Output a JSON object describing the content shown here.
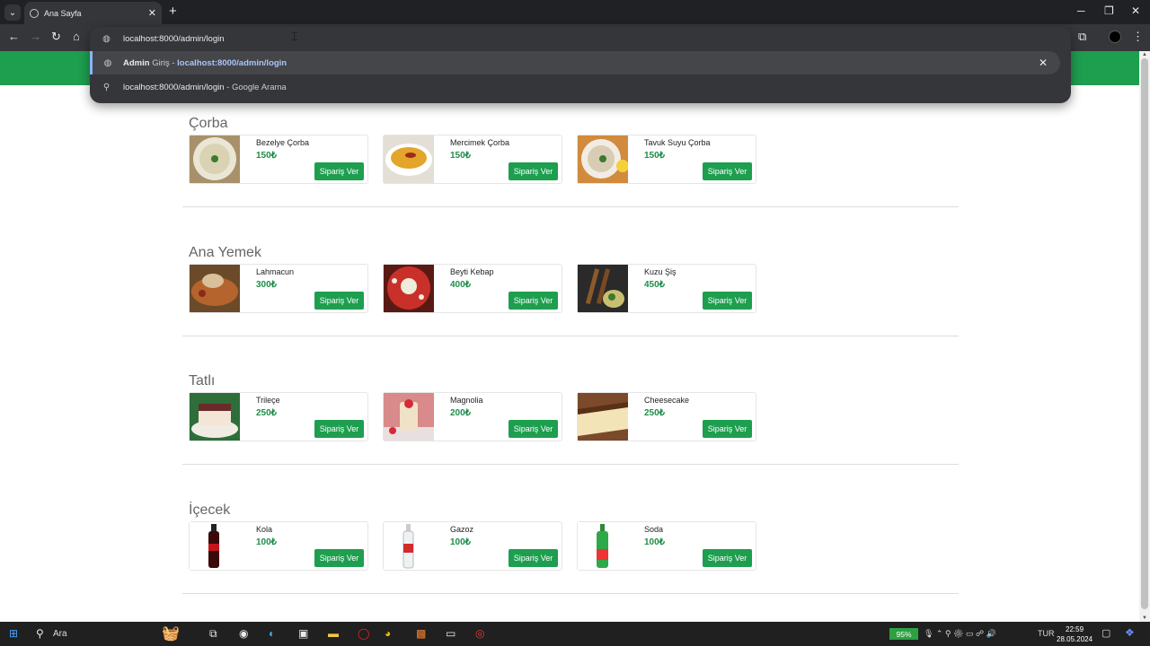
{
  "browser": {
    "tab_title": "Ana Sayfa",
    "address": "localhost:8000/admin/login",
    "suggestions": {
      "selected_bold": "Admin",
      "selected_rest": " Giriş - ",
      "selected_url": "localhost:8000/admin/login",
      "search_text": "localhost:8000/admin/login",
      "search_suffix": " - Google Arama"
    }
  },
  "menu": {
    "order_label": "Sipariş Ver",
    "sections": [
      {
        "title": "Çorba",
        "items": [
          {
            "name": "Bezelye Çorba",
            "price": "150₺"
          },
          {
            "name": "Mercimek Çorba",
            "price": "150₺"
          },
          {
            "name": "Tavuk Suyu Çorba",
            "price": "150₺"
          }
        ]
      },
      {
        "title": "Ana Yemek",
        "items": [
          {
            "name": "Lahmacun",
            "price": "300₺"
          },
          {
            "name": "Beyti Kebap",
            "price": "400₺"
          },
          {
            "name": "Kuzu Şiş",
            "price": "450₺"
          }
        ]
      },
      {
        "title": "Tatlı",
        "items": [
          {
            "name": "Trileçe",
            "price": "250₺"
          },
          {
            "name": "Magnolia",
            "price": "200₺"
          },
          {
            "name": "Cheesecake",
            "price": "250₺"
          }
        ]
      },
      {
        "title": "İçecek",
        "items": [
          {
            "name": "Kola",
            "price": "100₺"
          },
          {
            "name": "Gazoz",
            "price": "100₺"
          },
          {
            "name": "Soda",
            "price": "100₺"
          }
        ]
      }
    ]
  },
  "taskbar": {
    "search_label": "Ara",
    "battery": "95%",
    "language": "TUR",
    "time": "22:59",
    "date": "28.05.2024"
  },
  "colors": {
    "brand": "#1e9e4f",
    "price": "#1e8e4a"
  }
}
